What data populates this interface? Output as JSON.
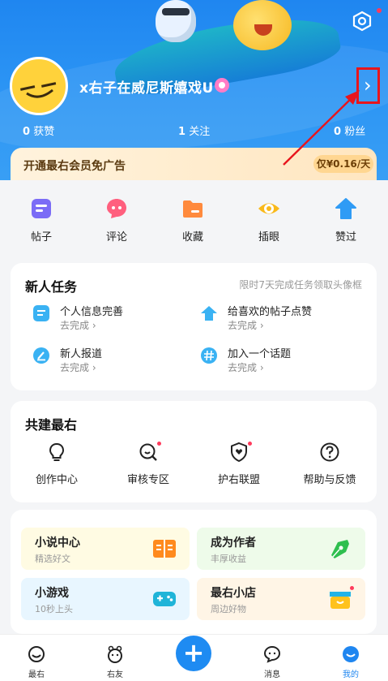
{
  "profile": {
    "username": "x右子在威尼斯嬉戏U",
    "stats": [
      {
        "count": "0",
        "label": "获赞"
      },
      {
        "count": "1",
        "label": "关注"
      },
      {
        "count": "0",
        "label": "粉丝"
      }
    ]
  },
  "vip": {
    "text": "开通最右会员免广告",
    "price": "仅¥0.16/天"
  },
  "quick_actions": [
    {
      "label": "帖子",
      "icon": "post-icon",
      "color": "#7b6cf6"
    },
    {
      "label": "评论",
      "icon": "comment-icon",
      "color": "#ff5f7e"
    },
    {
      "label": "收藏",
      "icon": "folder-icon",
      "color": "#ff8a3d"
    },
    {
      "label": "插眼",
      "icon": "eye-icon",
      "color": "#f9b91a"
    },
    {
      "label": "赞过",
      "icon": "thumb-up-icon",
      "color": "#2f9bf5"
    }
  ],
  "tasks": {
    "title": "新人任务",
    "subtitle": "限时7天完成任务领取头像框",
    "items": [
      {
        "name": "个人信息完善",
        "status": "去完成 ›",
        "icon": "profile-doc-icon"
      },
      {
        "name": "给喜欢的帖子点赞",
        "status": "去完成 ›",
        "icon": "like-up-icon"
      },
      {
        "name": "新人报道",
        "status": "去完成 ›",
        "icon": "pen-icon"
      },
      {
        "name": "加入一个话题",
        "status": "去完成 ›",
        "icon": "hashtag-icon"
      }
    ]
  },
  "build": {
    "title": "共建最右",
    "items": [
      {
        "label": "创作中心",
        "icon": "lightbulb-icon",
        "dot": false
      },
      {
        "label": "审核专区",
        "icon": "review-search-icon",
        "dot": true
      },
      {
        "label": "护右联盟",
        "icon": "shield-heart-icon",
        "dot": true
      },
      {
        "label": "帮助与反馈",
        "icon": "help-icon",
        "dot": false
      }
    ]
  },
  "services": [
    {
      "title": "小说中心",
      "sub": "精选好文",
      "icon": "book-icon",
      "bg": "#fffbe3"
    },
    {
      "title": "成为作者",
      "sub": "丰厚收益",
      "icon": "fountain-pen-icon",
      "bg": "#eefbea"
    },
    {
      "title": "小游戏",
      "sub": "10秒上头",
      "icon": "gamepad-icon",
      "bg": "#e8f6ff"
    },
    {
      "title": "最右小店",
      "sub": "周边好物",
      "icon": "shop-icon",
      "bg": "#fff5e6"
    }
  ],
  "nav": [
    {
      "label": "最右",
      "icon": "home-face-icon"
    },
    {
      "label": "右友",
      "icon": "friends-icon"
    },
    {
      "label": "消息",
      "icon": "message-icon"
    },
    {
      "label": "我的",
      "icon": "me-icon",
      "active": true
    }
  ],
  "colors": {
    "brand": "#1f86f0",
    "alert_dot": "#ff3b5c",
    "highlight_box": "#e8151c"
  }
}
